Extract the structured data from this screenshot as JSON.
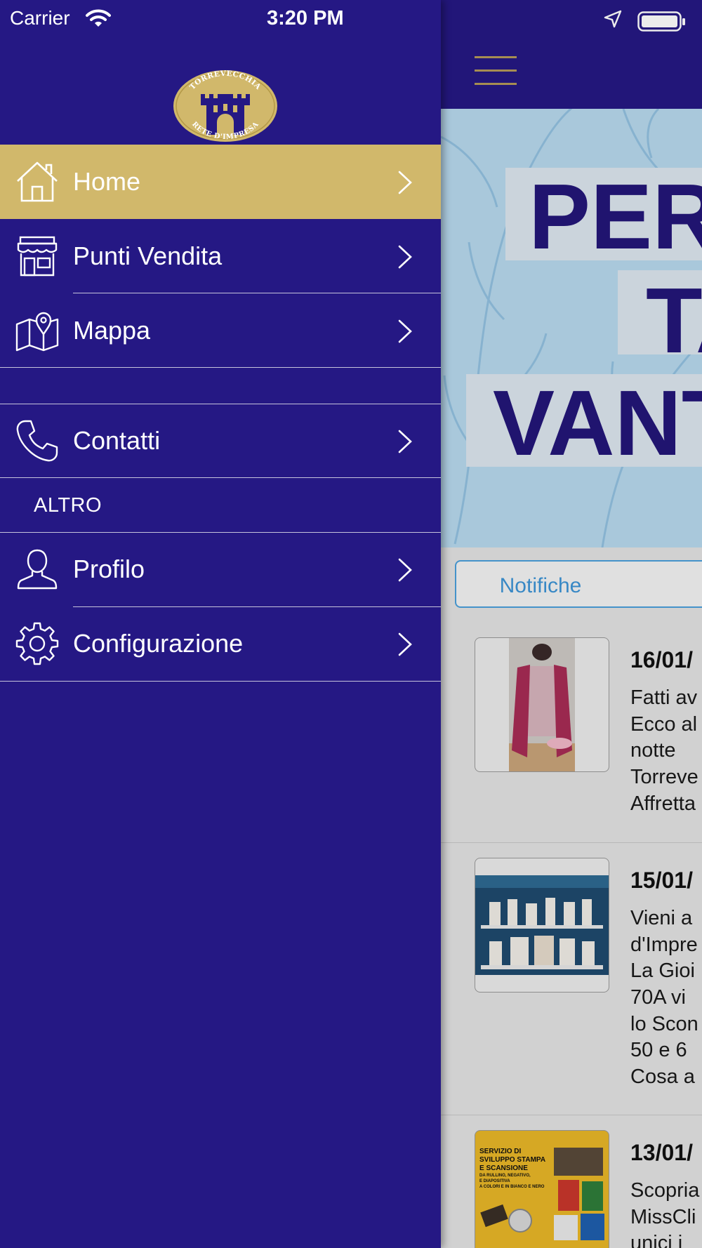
{
  "status_bar": {
    "carrier": "Carrier",
    "time": "3:20 PM"
  },
  "logo": {
    "top_text": "TORREVECCHIA",
    "bottom_text": "RETE D'IMPRESA"
  },
  "menu": {
    "items": [
      {
        "label": "Home",
        "icon": "home-icon",
        "selected": true
      },
      {
        "label": "Punti Vendita",
        "icon": "store-icon",
        "selected": false
      },
      {
        "label": "Mappa",
        "icon": "map-icon",
        "selected": false
      },
      {
        "label": "Contatti",
        "icon": "phone-icon",
        "selected": false
      },
      {
        "label": "Profilo",
        "icon": "user-icon",
        "selected": false
      },
      {
        "label": "Configurazione",
        "icon": "gear-icon",
        "selected": false
      }
    ],
    "section_altro": "ALTRO"
  },
  "colors": {
    "drawer_bg": "#251884",
    "selected_bg": "#d1b86b",
    "accent_blue": "#3d94d6",
    "gold": "#b59a5a"
  },
  "banner": {
    "line1": "PER",
    "line2": "TA",
    "line3": "VANTA"
  },
  "notifications": {
    "button_label": "Notifiche",
    "items": [
      {
        "date": "16/01/",
        "lines": [
          "Fatti av",
          "Ecco al",
          "notte",
          "Torreve",
          "Affretta"
        ]
      },
      {
        "date": "15/01/",
        "lines": [
          "Vieni a",
          "d'Impre",
          "La Gioi",
          "70A vi",
          "lo Scon",
          "50 e 6",
          "Cosa a"
        ]
      },
      {
        "date": "13/01/",
        "lines": [
          "Scopria",
          "MissCli",
          "unici i"
        ],
        "thumb_text": [
          "SERVIZIO DI",
          "SVILUPPO STAMPA",
          "E SCANSIONE",
          "DA RULLINO, NEGATIVO,",
          "E DIAPOSITIVA",
          "A COLORI E IN BIANCO E NERO"
        ]
      }
    ]
  }
}
